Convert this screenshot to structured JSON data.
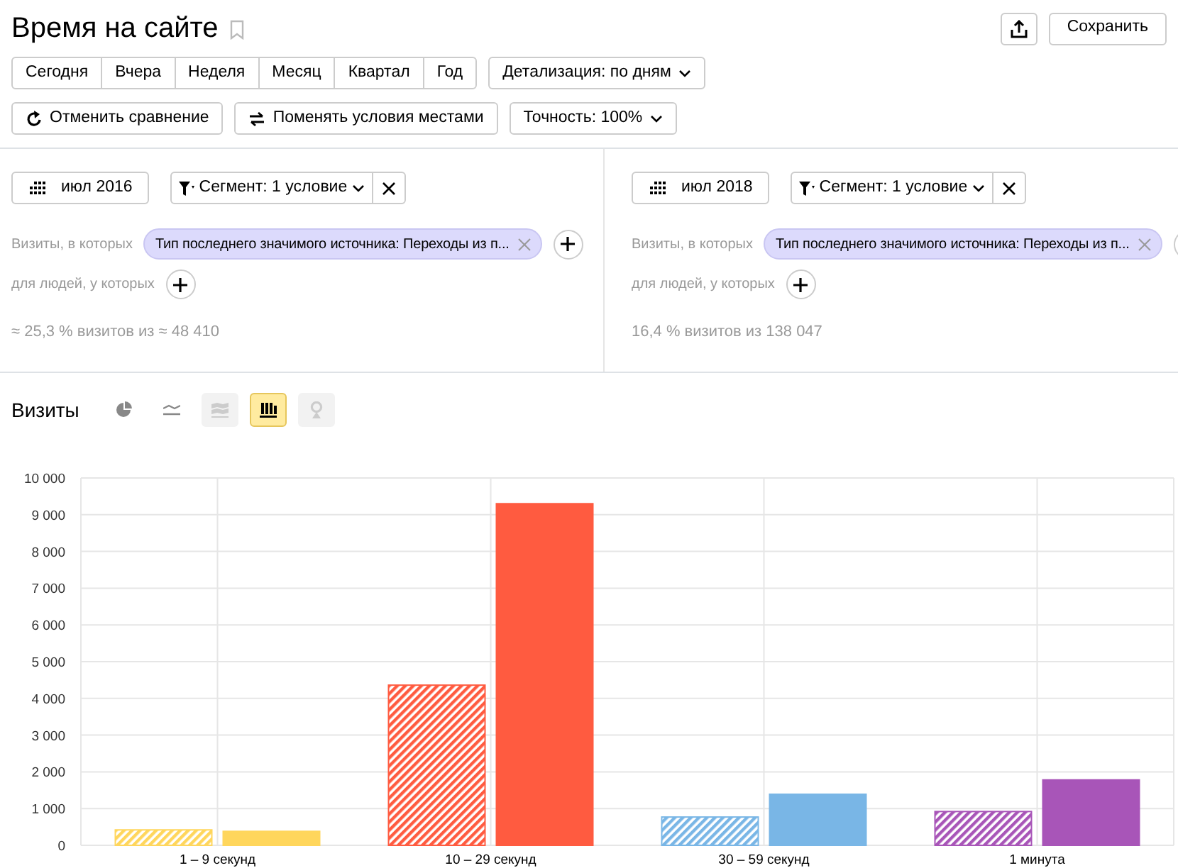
{
  "page": {
    "title": "Время на сайте",
    "bookmarked": false
  },
  "header_buttons": [
    {
      "kind": "share"
    },
    {
      "kind": "text",
      "label": "Сохранить"
    }
  ],
  "periods": [
    {
      "label": "Сегодня",
      "selected": false
    },
    {
      "label": "Вчера",
      "selected": false
    },
    {
      "label": "Неделя",
      "selected": false
    },
    {
      "label": "Месяц",
      "selected": false
    },
    {
      "label": "Квартал",
      "selected": false
    },
    {
      "label": "Год",
      "selected": false
    }
  ],
  "detail_dropdown": "Детализация: по дням",
  "compare_actions": [
    {
      "kind": "undo",
      "label": "Отменить сравнение"
    },
    {
      "kind": "swap",
      "label": "Поменять условия местами"
    },
    {
      "kind": "dropdown",
      "label": "Точность: 100%"
    }
  ],
  "segments": [
    {
      "period": "июл 2016",
      "segment": "Сегмент: 1 условие",
      "visits_label": "Визиты, в которых",
      "condition": "Тип последнего значимого источника: Переходы из п...",
      "people_label": "для людей, у которых",
      "summary": "≈ 25,3 % визитов из ≈ 48 410"
    },
    {
      "period": "июл 2018",
      "segment": "Сегмент: 1 условие",
      "visits_label": "Визиты, в которых",
      "condition": "Тип последнего значимого источника: Переходы из п...",
      "people_label": "для людей, у которых",
      "summary": "16,4 % визитов из 138 047"
    }
  ],
  "chart_section": {
    "title": "Визиты",
    "view_types": [
      {
        "kind": "pie",
        "selected": false,
        "disabled": false
      },
      {
        "kind": "line",
        "selected": false,
        "disabled": false
      },
      {
        "kind": "area",
        "selected": false,
        "disabled": true
      },
      {
        "kind": "bar",
        "selected": true,
        "disabled": false
      },
      {
        "kind": "map",
        "selected": false,
        "disabled": true
      }
    ],
    "chart_data": {
      "type": "bar",
      "grid": true,
      "categories": [
        "1 – 9 секунд",
        "10 – 29 секунд",
        "30 – 59 секунд",
        "1 минута"
      ],
      "series": [
        {
          "colors": [
            "#ffd65c",
            "#ff5b40",
            "#79b6e6",
            "#a855b8"
          ],
          "values": [
            420,
            4360,
            770,
            920
          ]
        },
        {
          "colors": [
            "#ffd65c",
            "#ff5b40",
            "#79b6e6",
            "#a855b8"
          ],
          "values": [
            380,
            9300,
            1390,
            1780
          ]
        }
      ],
      "ylim": [
        0,
        10000
      ],
      "yticks": [
        {
          "value": 0,
          "label": "0"
        },
        {
          "value": 1000,
          "label": "1 000"
        },
        {
          "value": 2000,
          "label": "2 000"
        },
        {
          "value": 3000,
          "label": "3 000"
        },
        {
          "value": 4000,
          "label": "4 000"
        },
        {
          "value": 5000,
          "label": "5 000"
        },
        {
          "value": 6000,
          "label": "6 000"
        },
        {
          "value": 7000,
          "label": "7 000"
        },
        {
          "value": 8000,
          "label": "8 000"
        },
        {
          "value": 9000,
          "label": "9 000"
        },
        {
          "value": 10000,
          "label": "10 000"
        }
      ]
    }
  }
}
